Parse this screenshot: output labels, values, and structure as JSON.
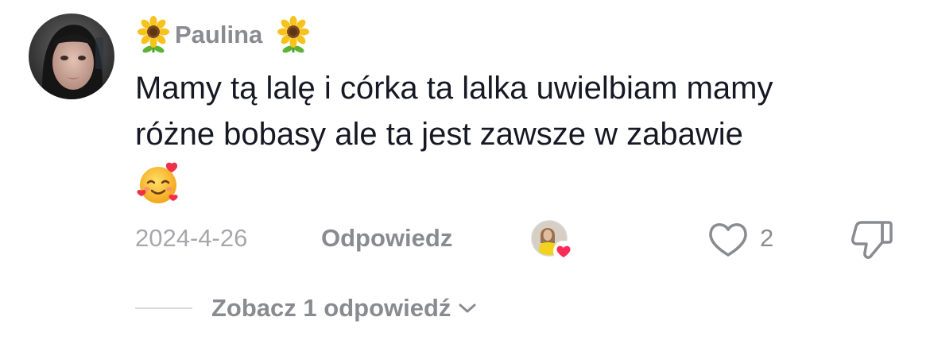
{
  "comment": {
    "author": "Paulina",
    "author_prefix_icon": "sunflower-emoji",
    "author_suffix_icon": "sunflower-emoji",
    "text_lines": [
      "Mamy tą lalę i córka ta lalka uwielbiam mamy",
      "różne bobasy ale ta jest zawsze w zabawie"
    ],
    "text_emoji": "smiling-face-with-hearts",
    "date": "2024-4-26",
    "reply_label": "Odpowiedz",
    "creator_liked_icon": "creator-avatar-heart",
    "like_icon": "heart-outline-icon",
    "like_count": "2",
    "dislike_icon": "thumbs-down-icon"
  },
  "replies": {
    "view_label": "Zobacz 1 odpowiedź",
    "chevron_icon": "chevron-down-icon"
  },
  "colors": {
    "primary_text": "#161823",
    "secondary_text": "#8a8b91",
    "date_text": "#a7a8ad",
    "heart_red": "#fe2c55"
  }
}
